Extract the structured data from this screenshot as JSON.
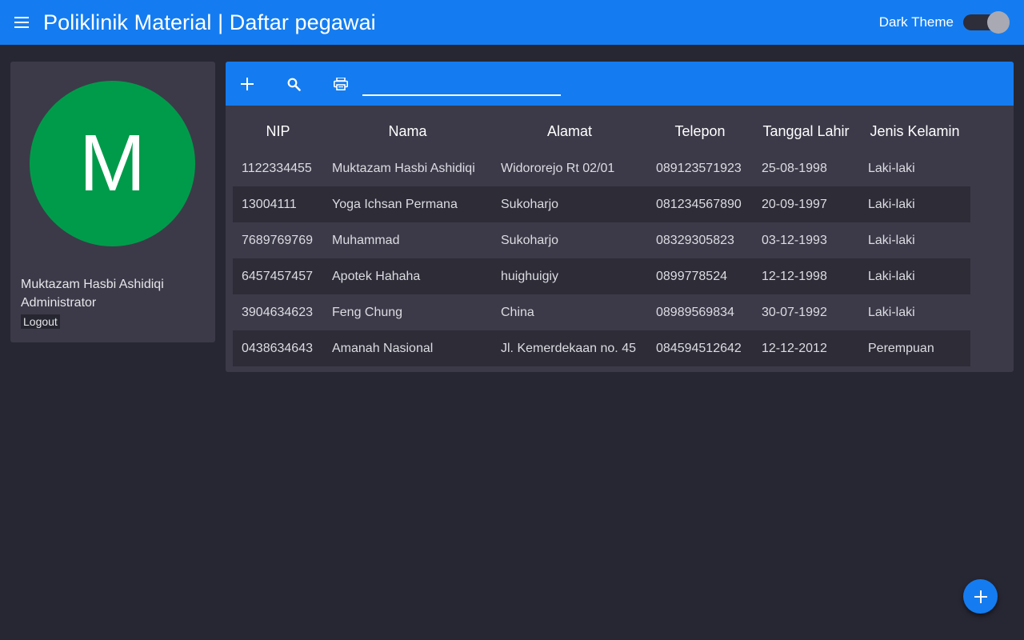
{
  "header": {
    "title": "Poliklinik Material | Daftar pegawai",
    "theme_label": "Dark Theme",
    "dark_theme_enabled": true
  },
  "profile": {
    "avatar_letter": "M",
    "name": "Muktazam Hasbi Ashidiqi",
    "role": "Administrator",
    "logout_label": "Logout"
  },
  "toolbar": {
    "search_value": ""
  },
  "table": {
    "columns": [
      "NIP",
      "Nama",
      "Alamat",
      "Telepon",
      "Tanggal Lahir",
      "Jenis Kelamin"
    ],
    "rows": [
      [
        "1122334455",
        "Muktazam Hasbi Ashidiqi",
        "Widororejo Rt 02/01",
        "089123571923",
        "25-08-1998",
        "Laki-laki"
      ],
      [
        "13004111",
        "Yoga Ichsan Permana",
        "Sukoharjo",
        "081234567890",
        "20-09-1997",
        "Laki-laki"
      ],
      [
        "7689769769",
        "Muhammad",
        "Sukoharjo",
        "08329305823",
        "03-12-1993",
        "Laki-laki"
      ],
      [
        "6457457457",
        "Apotek Hahaha",
        "huighuigiy",
        "0899778524",
        "12-12-1998",
        "Laki-laki"
      ],
      [
        "3904634623",
        "Feng Chung",
        "China",
        "08989569834",
        "30-07-1992",
        "Laki-laki"
      ],
      [
        "0438634643",
        "Amanah Nasional",
        "Jl. Kemerdekaan no. 45",
        "084594512642",
        "12-12-2012",
        "Perempuan"
      ]
    ]
  },
  "colors": {
    "primary": "#147cf0",
    "background": "#272633",
    "card": "#3c3a48",
    "avatar": "#009b4a"
  },
  "icons": {
    "menu": "menu-icon",
    "add": "plus-icon",
    "search": "search-icon",
    "print": "print-icon",
    "fab": "plus-icon"
  }
}
